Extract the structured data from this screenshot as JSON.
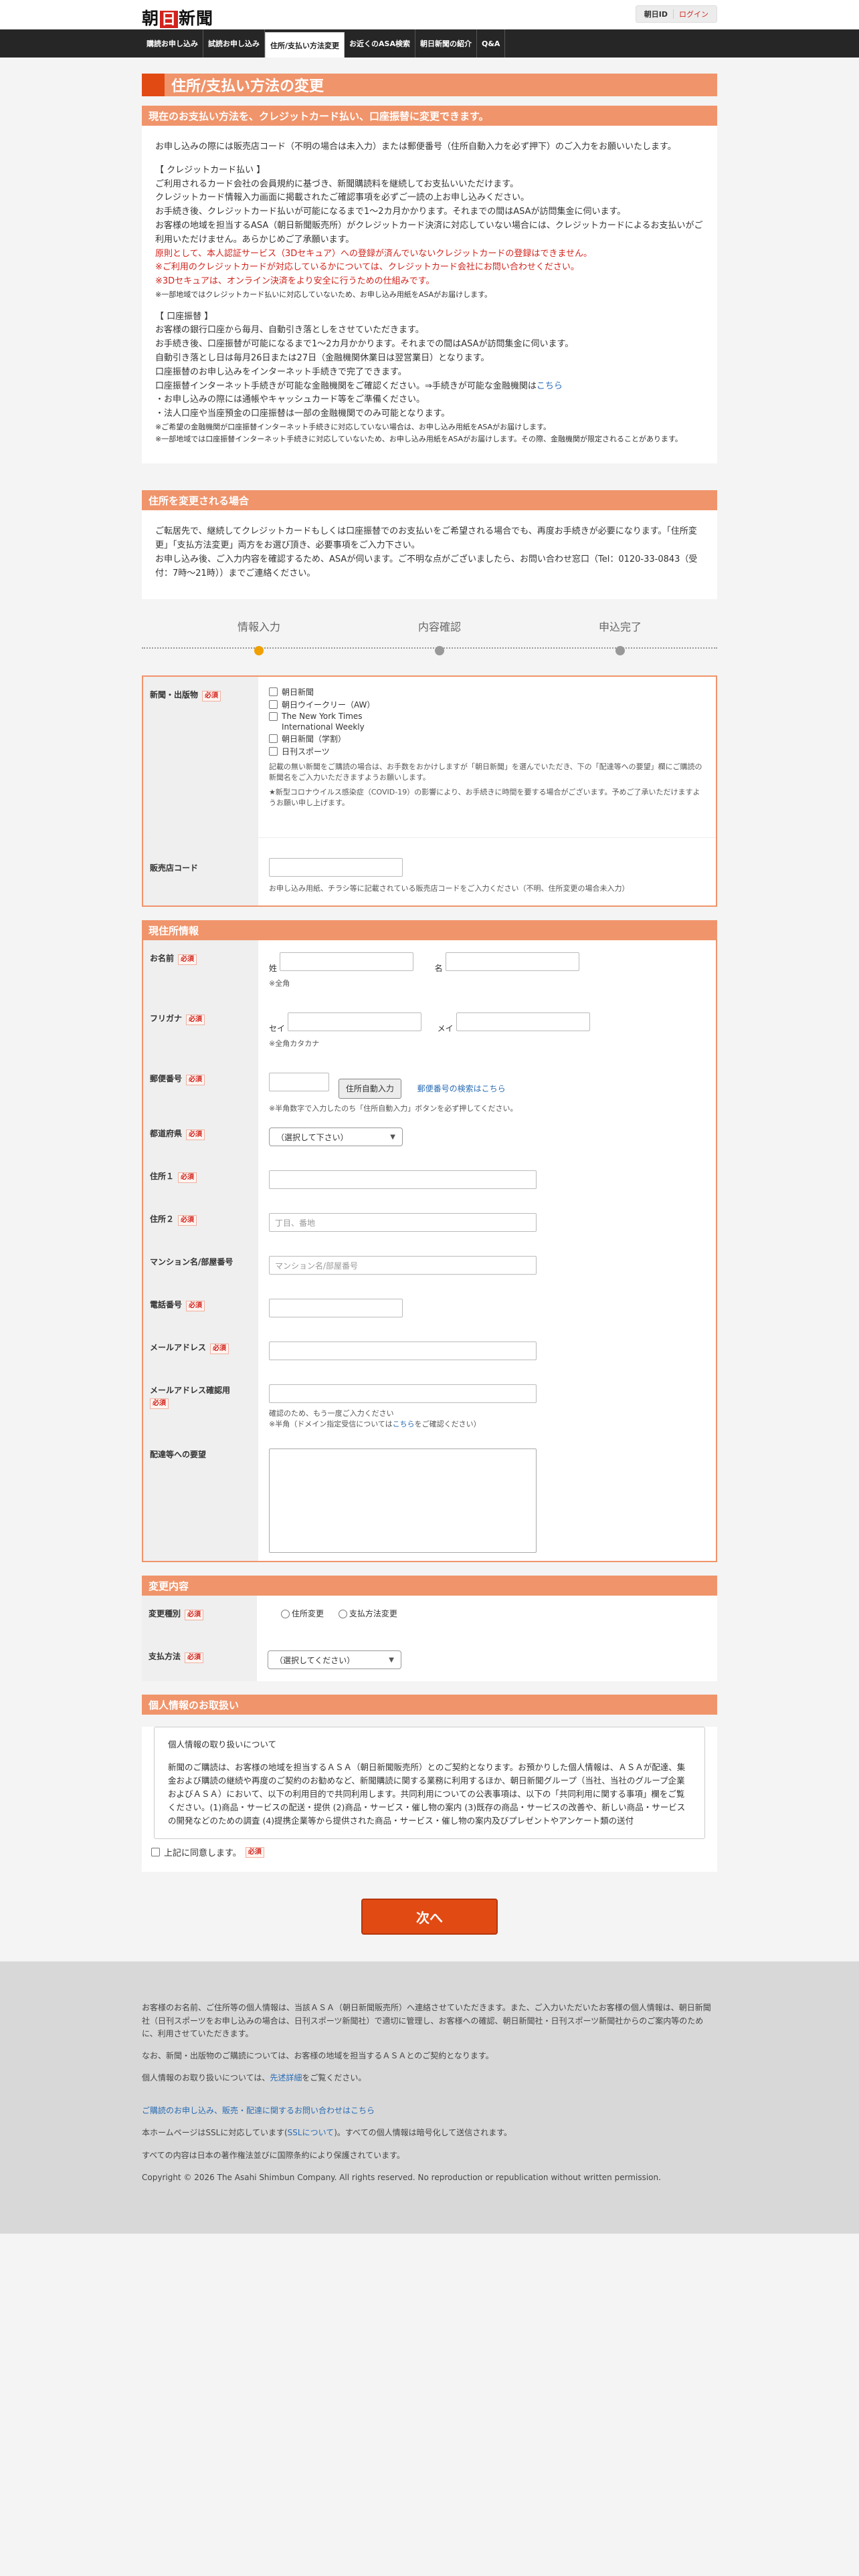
{
  "header": {
    "logo_part1": "朝",
    "logo_mark": "日",
    "logo_part2": "新聞",
    "id_label": "朝日ID",
    "login_label": "ログイン"
  },
  "nav": {
    "items": [
      {
        "label": "購読お申し込み"
      },
      {
        "label": "試読お申し込み"
      },
      {
        "label": "住所/支払い方法変更"
      },
      {
        "label": "お近くのASA検索"
      },
      {
        "label": "朝日新聞の紹介"
      },
      {
        "label": "Q&A"
      }
    ]
  },
  "page_title": "住所/支払い方法の変更",
  "sec1": {
    "heading": "現在のお支払い方法を、クレジットカード払い、口座振替に変更できます。",
    "intro": "お申し込みの際には販売店コード（不明の場合は未入力）または郵便番号（住所自動入力を必ず押下）のご入力をお願いいたします。",
    "cc_title": "【 クレジットカード払い 】",
    "cc_lines": [
      "ご利用されるカード会社の会員規約に基づき、新聞購読料を継続してお支払いいただけます。",
      "クレジットカード情報入力画面に掲載されたご確認事項を必ずご一読の上お申し込みください。",
      "お手続き後、クレジットカード払いが可能になるまで1〜2カ月かかります。それまでの間はASAが訪問集金に伺います。",
      "お客様の地域を担当するASA（朝日新聞販売所）がクレジットカード決済に対応していない場合には、クレジットカードによるお支払いがご利用いただけません。あらかじめご了承願います。"
    ],
    "cc_red1": "原則として、本人認証サービス（3Dセキュア）への登録が済んでいないクレジットカードの登録はできません。",
    "cc_red2": "※ご利用のクレジットカードが対応しているかについては、クレジットカード会社にお問い合わせください。",
    "cc_red3": "※3Dセキュアは、オンライン決済をより安全に行うための仕組みです。",
    "cc_note": "※一部地域ではクレジットカード払いに対応していないため、お申し込み用紙をASAがお届けします。",
    "bank_title": "【 口座振替 】",
    "bank_lines": [
      "お客様の銀行口座から毎月、自動引き落としをさせていただきます。",
      "お手続き後、口座振替が可能になるまで1〜2カ月かかります。それまでの間はASAが訪問集金に伺います。",
      "自動引き落とし日は毎月26日または27日（金融機関休業日は翌営業日）となります。",
      "口座振替のお申し込みをインターネット手続きで完了できます。"
    ],
    "bank_check_text": "口座振替インターネット手続きが可能な金融機関をご確認ください。⇒手続きが可能な金融機関は",
    "bank_check_link": "こちら",
    "bank_bullets": [
      "・お申し込みの際には通帳やキャッシュカード等をご準備ください。",
      "・法人口座や当座預金の口座振替は一部の金融機関でのみ可能となります。"
    ],
    "bank_notes": [
      "※ご希望の金融機関が口座振替インターネット手続きに対応していない場合は、お申し込み用紙をASAがお届けします。",
      "※一部地域では口座振替インターネット手続きに対応していないため、お申し込み用紙をASAがお届けします。その際、金融機関が限定されることがあります。"
    ]
  },
  "sec2": {
    "heading": "住所を変更される場合",
    "text1": "ご転居先で、継続してクレジットカードもしくは口座振替でのお支払いをご希望される場合でも、再度お手続きが必要になります。「住所変更」「支払方法変更」両方をお選び頂き、必要事項をご入力下さい。",
    "text2": "お申し込み後、ご入力内容を確認するため、ASAが伺います。ご不明な点がございましたら、お問い合わせ窓口（Tel：0120-33-0843（受付：7時〜21時））までご連絡ください。"
  },
  "steps": [
    {
      "label": "情報入力"
    },
    {
      "label": "内容確認"
    },
    {
      "label": "申込完了"
    }
  ],
  "newspaper_form": {
    "label": "新聞・出版物",
    "required": "必須",
    "options": [
      "朝日新聞",
      "朝日ウイークリー（AW）",
      "The New York Times",
      "International Weekly",
      "朝日新聞（学割）",
      "日刊スポーツ"
    ],
    "note": "記載の無い新聞をご購読の場合は、お手数をおかけしますが「朝日新聞」を選んでいただき、下の「配達等への要望」欄にご購読の新聞名をご入力いただきますようお願いします。",
    "red_note": "★新型コロナウイルス感染症（COVID-19）の影響により、お手続きに時間を要する場合がございます。予めご了承いただけますようお願い申し上げます。",
    "shop_label": "販売店コード",
    "shop_note": "お申し込み用紙、チラシ等に記載されている販売店コードをご入力ください（不明、住所変更の場合未入力）"
  },
  "current": {
    "heading": "現住所情報",
    "name_label": "お名前",
    "sei": "姓",
    "mei": "名",
    "name_note": "※全角",
    "kana_label": "フリガナ",
    "sei_kana": "セイ",
    "mei_kana": "メイ",
    "kana_note": "※全角カタカナ",
    "zip_label": "郵便番号",
    "zip_button": "住所自動入力",
    "zip_link": "郵便番号の検索はこちら",
    "zip_note": "※半角数字で入力したのち「住所自動入力」ボタンを必ず押してください。",
    "pref_label": "都道府県",
    "pref_select": "（選択して下さい）",
    "addr1_label": "住所１",
    "addr2_label": "住所２",
    "addr2_placeholder": "丁目、番地",
    "bldg_label": "マンション名/部屋番号",
    "bldg_placeholder": "マンション名/部屋番号",
    "tel_label": "電話番号",
    "mail_label": "メールアドレス",
    "mail2_label": "メールアドレス確認用",
    "mail2_note1": "確認のため、もう一度ご入力ください",
    "mail2_note2a": "※半角（ドメイン指定受信については",
    "mail2_note2_link": "こちら",
    "mail2_note2b": "をご確認ください）",
    "request_label": "配達等への要望",
    "required": "必須"
  },
  "change": {
    "heading": "変更内容",
    "type_label": "変更種別",
    "opt_address": "住所変更",
    "opt_payment": "支払方法変更",
    "pay_label": "支払方法",
    "pay_select": "（選択してください）",
    "required": "必須"
  },
  "privacy": {
    "heading": "個人情報のお取扱い",
    "box_title": "個人情報の取り扱いについて",
    "box_text": "新聞のご購読は、お客様の地域を担当するＡＳＡ（朝日新聞販売所）とのご契約となります。お預かりした個人情報は、ＡＳＡが配達、集金および購読の継続や再度のご契約のお勧めなど、新聞購読に関する業務に利用するほか、朝日新聞グループ（当社、当社のグループ企業およびＡＳＡ）において、以下の利用目的で共同利用します。共同利用についての公表事項は、以下の「共同利用に関する事項」欄をご覧ください。(1)商品・サービスの配送・提供 (2)商品・サービス・催し物の案内 (3)既存の商品・サービスの改善や、新しい商品・サービスの開発などのための調査 (4)提携企業等から提供された商品・サービス・催し物の案内及びプレゼントやアンケート類の送付",
    "agree_label": "上記に同意します。",
    "required": "必須"
  },
  "next_button": "次へ",
  "footer": {
    "p1": "お客様のお名前、ご住所等の個人情報は、当該ＡＳＡ（朝日新聞販売所）へ連絡させていただきます。また、ご入力いただいたお客様の個人情報は、朝日新聞社（日刊スポーツをお申し込みの場合は、日刊スポーツ新聞社）で適切に管理し、お客様への確認、朝日新聞社・日刊スポーツ新聞社からのご案内等のために、利用させていただきます。",
    "p2": "なお、新聞・出版物のご購読については、お客様の地域を担当するＡＳＡとのご契約となります。",
    "p3a": "個人情報のお取り扱いについては、",
    "p3_link": "先述詳細",
    "p3b": "をご覧ください。",
    "p4_link": "ご購読のお申し込み、販売・配達に関するお問い合わせはこちら",
    "p5a": "本ホームページはSSLに対応しています(",
    "p5_link": "SSLについて",
    "p5b": ")。すべての個人情報は暗号化して送信されます。",
    "p6": "すべての内容は日本の著作権法並びに国際条約により保護されています。",
    "copyright": "Copyright © 2026 The Asahi Shimbun Company. All rights reserved. No reproduction or republication without written permission."
  }
}
